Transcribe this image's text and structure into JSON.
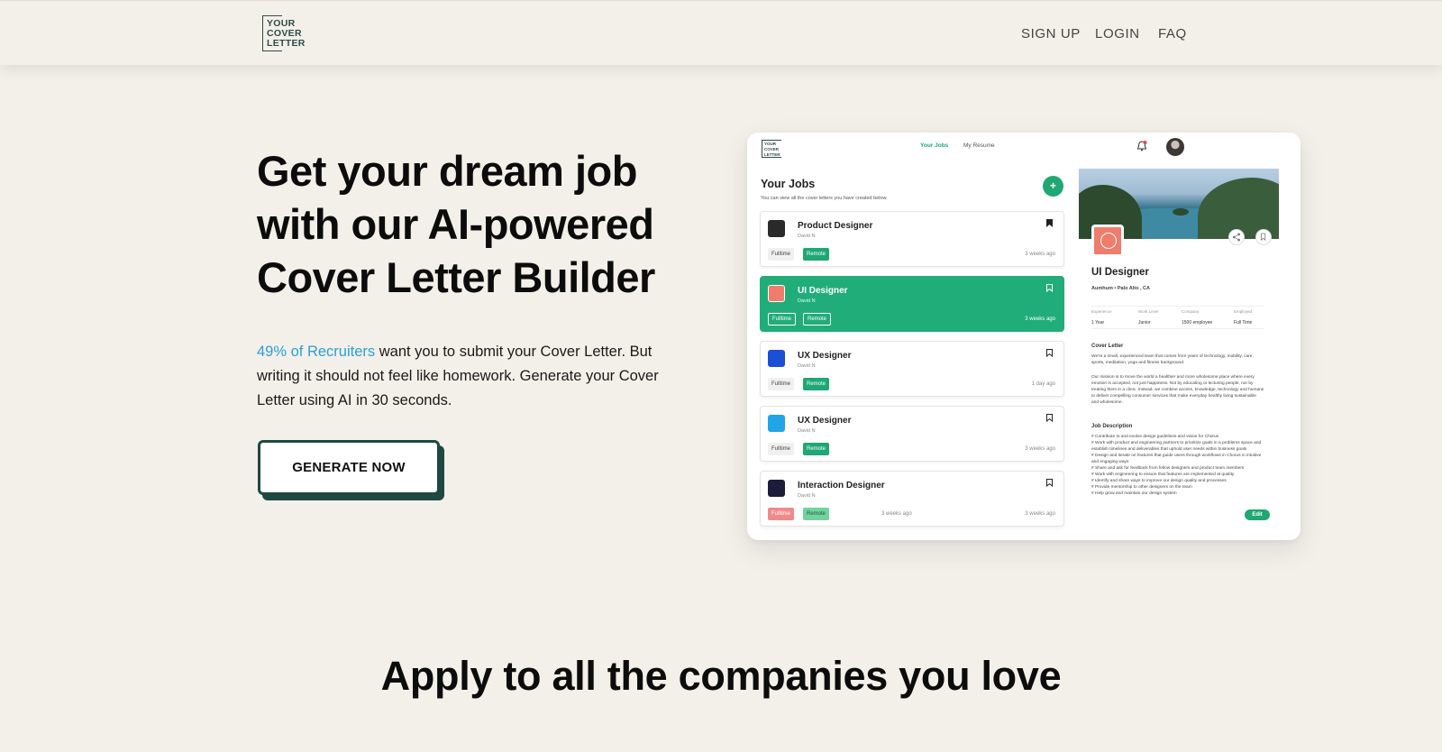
{
  "header": {
    "logo_lines": [
      "YOUR",
      "COVER",
      "LETTER"
    ],
    "nav": {
      "signup": "SIGN UP",
      "login": "LOGIN",
      "faq": "FAQ"
    }
  },
  "hero": {
    "title": "Get your dream job with our AI-powered Cover Letter Builder",
    "desc_accent": "49% of Recruiters",
    "desc_rest": " want you to submit your Cover Letter. But writing it should not feel like homework. Generate your Cover Letter using AI in 30 seconds.",
    "cta": "GENERATE NOW"
  },
  "mockup": {
    "tabs": [
      "Your Jobs",
      "My Resume"
    ],
    "heading": "Your Jobs",
    "subheading": "You can view all the cover letters you have created below.",
    "add": "+",
    "cards": [
      {
        "title": "Product Designer",
        "name": "David N",
        "tag1": "Fulltime",
        "tag2": "Remote",
        "when": "3 weeks ago",
        "logo_color": "#2a2a2a"
      },
      {
        "title": "UI Designer",
        "name": "David N",
        "tag1": "Fulltime",
        "tag2": "Remote",
        "when": "3 weeks ago",
        "logo_color": "#f07c6c"
      },
      {
        "title": "UX Designer",
        "name": "David N",
        "tag1": "Fulltime",
        "tag2": "Remote",
        "when": "1 day ago",
        "logo_color": "#1a4fd6"
      },
      {
        "title": "UX Designer",
        "name": "David N",
        "tag1": "Fulltime",
        "tag2": "Remote",
        "when": "3 weeks ago",
        "logo_color": "#22a4e6"
      },
      {
        "title": "Interaction Designer",
        "name": "David N",
        "tag1": "Fulltime",
        "tag2": "Remote",
        "when": "3 weeks ago",
        "when_mid": "3 weeks ago",
        "logo_color": "#1c1d3d"
      }
    ],
    "detail": {
      "title": "UI Designer",
      "company": "Aumhum",
      "location": "Palo Alto , CA",
      "grid": [
        {
          "k": "Experience",
          "v": "1 Year"
        },
        {
          "k": "Work Level",
          "v": "Junior"
        },
        {
          "k": "Company",
          "v": "1500 employee"
        },
        {
          "k": "Employed",
          "v": "Full Time"
        }
      ],
      "cover_heading": "Cover Letter",
      "cover_p1": "We're a small, experienced team that comes from years of technology, mobility, care, sports, meditation, yoga and fitness background.",
      "cover_p2": "Our mission is to move the world a healthier and more wholesome place where every emotion is accepted, not just happiness. Not by educating or lecturing people, nor by treating them in a clinic. Instead, we combine access, knowledge, technology and humans to deliver compelling consumer services that make everyday healthy living sustainable and wholesome.",
      "job_heading": "Job Description",
      "job_lines": [
        "# Contribute to and evolve design guidelines and vision for Chorus",
        "# Work with product and engineering partners to prioritize goals in a problems space and establish timelines and deliverables that uphold user needs within business goals",
        "# Design and iterate on features that guide users through workflows in Chorus in intuitive and engaging ways",
        "# Share and ask for feedback from fellow designers and product team members",
        "# Work with engineering to ensure that features are implemented at quality",
        "# Identify and share ways to improve our design quality and processes",
        "# Provide mentorship to other designers on the team",
        "# Help grow and maintain our design system"
      ],
      "edit": "Edit"
    }
  },
  "section": {
    "title": "Apply to all the companies you love"
  }
}
